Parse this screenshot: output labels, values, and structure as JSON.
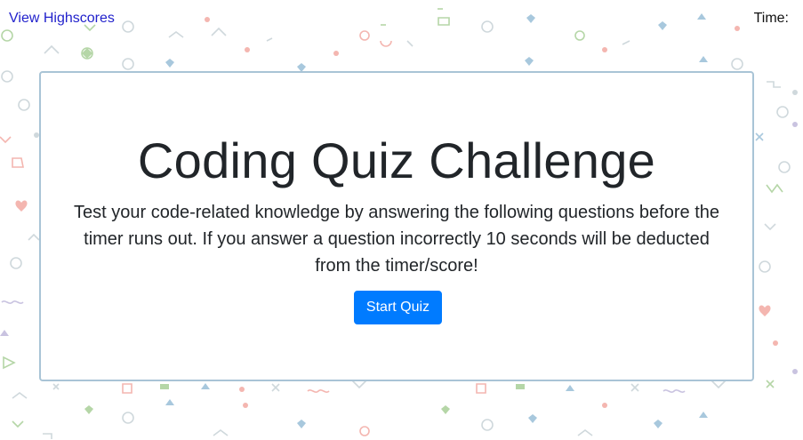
{
  "header": {
    "highscores_link": "View Highscores",
    "timer_label": "Time:",
    "timer_value": ""
  },
  "quiz": {
    "title": "Coding Quiz Challenge",
    "description": "Test your code-related knowledge by answering the following questions before the timer runs out. If you answer a question incorrectly 10 seconds will be deducted from the timer/score!",
    "start_button": "Start Quiz"
  },
  "colors": {
    "accent": "#007bff",
    "link": "#2222cc",
    "card_border": "#a9c4d6",
    "pattern_green": "#b5d6a7",
    "pattern_pink": "#f4b6b0",
    "pattern_blue": "#a8c8dd",
    "pattern_purple": "#c9c3e0"
  }
}
